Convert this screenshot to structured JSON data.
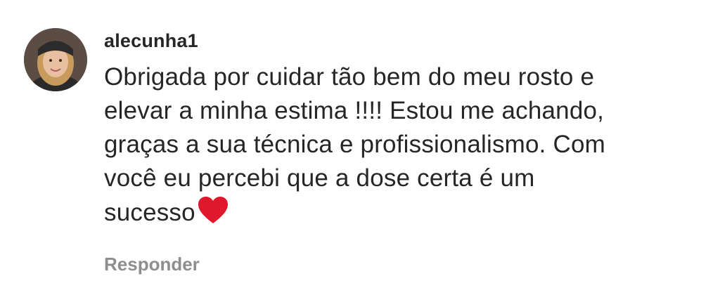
{
  "comment": {
    "username": "alecunha1",
    "lines": [
      "Obrigada por cuidar tão bem do meu rosto e",
      "elevar a minha estima !!!! Estou me achando,",
      "graças a sua técnica e profissionalismo. Com",
      "você eu percebi que a dose certa é um",
      "sucesso"
    ],
    "emoji": "heart-icon",
    "emoji_color": "#e0182d",
    "reply_label": "Responder",
    "reply_color": "#8e8e8e",
    "text_color": "#262626"
  }
}
